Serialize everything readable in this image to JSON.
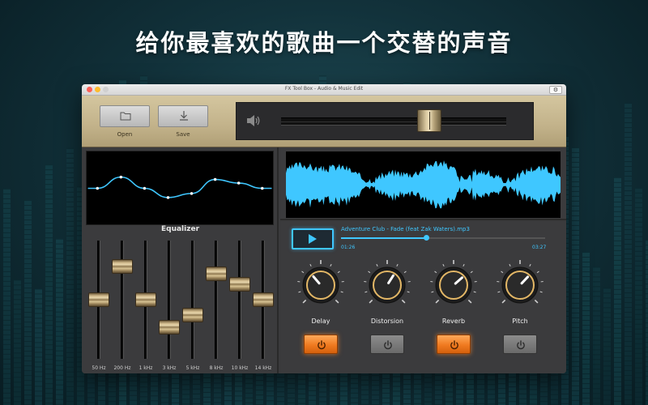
{
  "promo": {
    "headline": "给你最喜欢的歌曲一个交替的声音"
  },
  "window": {
    "title": "FX Tool Box - Audio & Music Edit",
    "settings_icon": "gear-icon"
  },
  "toolbar": {
    "open_label": "Open",
    "open_icon": "folder-icon",
    "save_label": "Save",
    "save_icon": "download-arrow-icon",
    "volume_icon": "speaker-icon",
    "volume_level": 0.66
  },
  "equalizer": {
    "title": "Equalizer",
    "bands": [
      {
        "label": "50 Hz",
        "level": 0.5
      },
      {
        "label": "200 Hz",
        "level": 0.78
      },
      {
        "label": "1 kHz",
        "level": 0.5
      },
      {
        "label": "3 kHz",
        "level": 0.27
      },
      {
        "label": "5 kHz",
        "level": 0.37
      },
      {
        "label": "8 kHz",
        "level": 0.72
      },
      {
        "label": "10 kHz",
        "level": 0.63
      },
      {
        "label": "14 kHz",
        "level": 0.5
      }
    ]
  },
  "player": {
    "track": "Adventure Club - Fade (feat Zak Waters).mp3",
    "elapsed": "01:26",
    "total": "03:27",
    "progress": 0.42,
    "play_icon": "play-icon"
  },
  "effects": [
    {
      "label": "Delay",
      "value": 0.35,
      "enabled": true
    },
    {
      "label": "Distorsion",
      "value": 0.62,
      "enabled": false
    },
    {
      "label": "Reverb",
      "value": 0.68,
      "enabled": true
    },
    {
      "label": "Pitch",
      "value": 0.66,
      "enabled": false
    }
  ],
  "colors": {
    "accent": "#3fc7ff",
    "effect_on": "#f07a20",
    "toolbar": "#c2b28a",
    "knob_ring": "#e3b766"
  }
}
